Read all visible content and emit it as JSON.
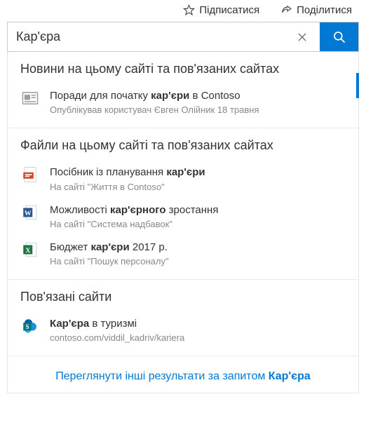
{
  "topbar": {
    "follow_label": "Підписатися",
    "share_label": "Поділитися"
  },
  "search": {
    "value": "Кар'єра"
  },
  "highlight_term": "кар'єр",
  "news": {
    "heading": "Новини на цьому сайті та пов'язаних сайтах",
    "items": [
      {
        "title_pre": "Поради для початку ",
        "title_hl": "кар'єри",
        "title_post": " в Contoso",
        "meta": "Опублікував користувач Євген Олійник 18 травня"
      }
    ]
  },
  "files": {
    "heading": "Файли на цьому сайті та пов'язаних сайтах",
    "items": [
      {
        "icon": "pdf",
        "title_pre": "Посібник із планування ",
        "title_hl": "кар'єри",
        "title_post": "",
        "meta": "На сайті \"Життя в Contoso\""
      },
      {
        "icon": "word",
        "title_pre": "Можливості ",
        "title_hl": "кар'єрного",
        "title_post": " зростання",
        "meta": "На сайті \"Система надбавок\""
      },
      {
        "icon": "excel",
        "title_pre": "Бюджет ",
        "title_hl": "кар'єри",
        "title_post": " 2017 р.",
        "meta": "На сайті \"Пошук персоналу\""
      }
    ]
  },
  "sites": {
    "heading": "Пов'язані сайти",
    "items": [
      {
        "title_pre": "",
        "title_hl": "Кар'єра",
        "title_post": " в туризмі",
        "meta": "contoso.com/viddil_kadriv/kariera"
      }
    ]
  },
  "footer": {
    "text_pre": "Переглянути інші результати за запитом ",
    "text_hl": "Кар'єра"
  }
}
